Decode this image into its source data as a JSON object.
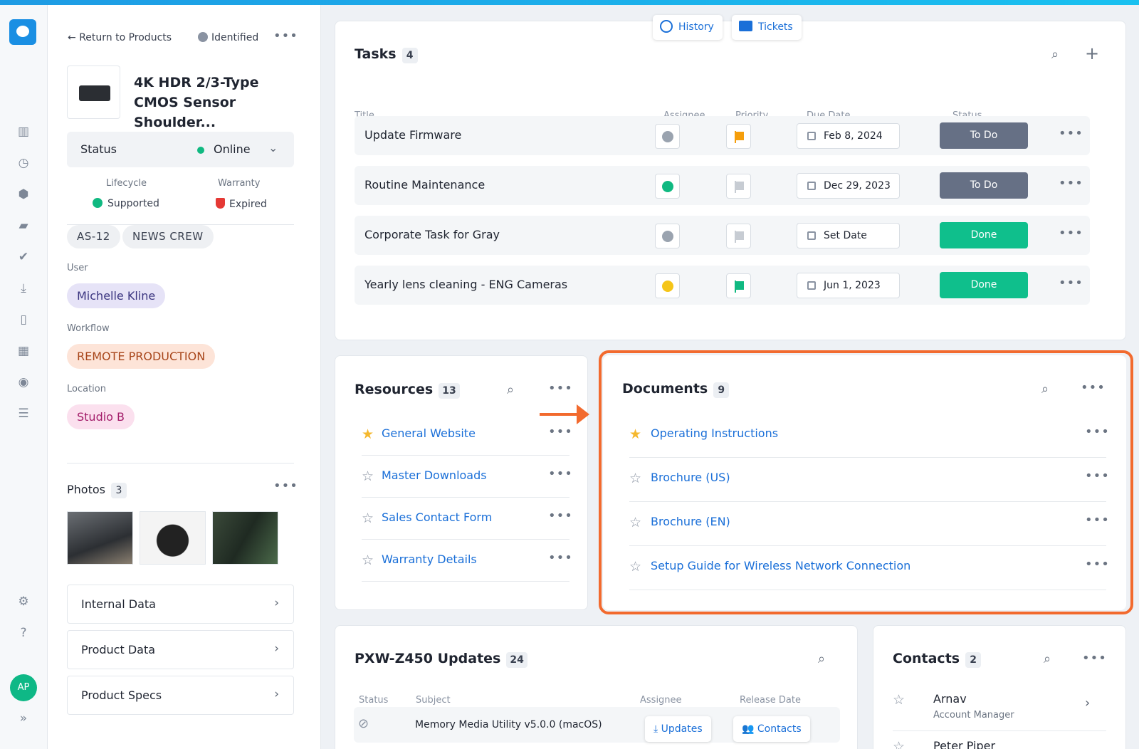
{
  "product": {
    "back_label": "Return to Products",
    "identified_label": "Identified",
    "title": "4K HDR 2/3-Type CMOS Sensor Shoulder...",
    "status_label": "Status",
    "status_value": "Online",
    "lifecycle_label": "Lifecycle",
    "lifecycle_value": "Supported",
    "warranty_label": "Warranty",
    "warranty_value": "Expired",
    "tags": [
      "AS-12",
      "NEWS CREW"
    ],
    "user_label": "User",
    "user_value": "Michelle Kline",
    "workflow_label": "Workflow",
    "workflow_value": "REMOTE PRODUCTION",
    "location_label": "Location",
    "location_value": "Studio B",
    "photos_label": "Photos",
    "photos_count": "3",
    "sections": [
      "Internal Data",
      "Product Data",
      "Product Specs"
    ]
  },
  "float_tabs": {
    "history": "History",
    "tickets": "Tickets"
  },
  "tasks": {
    "title": "Tasks",
    "count": "4",
    "columns": [
      "Title",
      "Assignee",
      "Priority",
      "Due Date",
      "Status"
    ],
    "rows": [
      {
        "title": "Update Firmware",
        "due": "Feb 8, 2024",
        "status": "To Do",
        "assignee_color": "#9aa3af",
        "flag_color": "#f59e0b"
      },
      {
        "title": "Routine Maintenance",
        "due": "Dec 29, 2023",
        "status": "To Do",
        "assignee_color": "#10b981",
        "flag_color": "#c7ccd3"
      },
      {
        "title": "Corporate Task for Gray",
        "due": "Set Date",
        "status": "Done",
        "assignee_color": "#9aa3af",
        "flag_color": "#c7ccd3"
      },
      {
        "title": "Yearly lens cleaning - ENG Cameras",
        "due": "Jun 1, 2023",
        "status": "Done",
        "assignee_color": "#f5c518",
        "flag_color": "#10b981"
      }
    ]
  },
  "resources": {
    "title": "Resources",
    "count": "13",
    "items": [
      "General Website",
      "Master Downloads",
      "Sales Contact Form",
      "Warranty Details"
    ]
  },
  "documents": {
    "title": "Documents",
    "count": "9",
    "items": [
      "Operating Instructions",
      "Brochure (US)",
      "Brochure (EN)",
      "Setup Guide for Wireless Network Connection"
    ]
  },
  "updates": {
    "title": "PXW-Z450 Updates",
    "count": "24",
    "columns": [
      "Status",
      "Subject",
      "Assignee",
      "Release Date"
    ],
    "row_subject": "Memory Media Utility v5.0.0 (macOS)",
    "btn_updates": "Updates",
    "btn_contacts": "Contacts"
  },
  "contacts": {
    "title": "Contacts",
    "count": "2",
    "items": [
      {
        "name": "Arnav",
        "role": "Account Manager"
      },
      {
        "name": "Peter Piper",
        "role": ""
      }
    ]
  },
  "user_initials": "AP",
  "colors": {
    "accent": "#1a6fd8",
    "todo": "#667085",
    "done": "#0fbf8c",
    "highlight": "#f26a2e"
  }
}
